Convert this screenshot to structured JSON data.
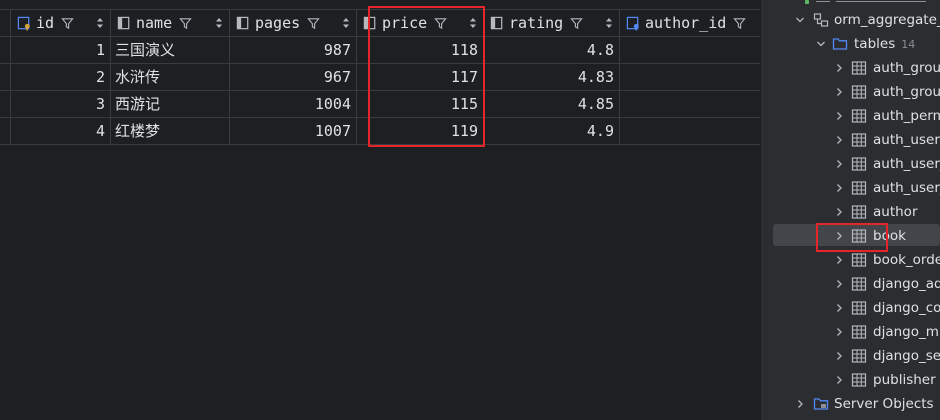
{
  "grid": {
    "columns": [
      {
        "name": "id",
        "icon": "key-column-icon"
      },
      {
        "name": "name",
        "icon": "column-icon"
      },
      {
        "name": "pages",
        "icon": "column-icon"
      },
      {
        "name": "price",
        "icon": "column-icon"
      },
      {
        "name": "rating",
        "icon": "column-icon"
      },
      {
        "name": "author_id",
        "icon": "foreign-key-column-icon"
      }
    ],
    "rows": [
      {
        "id": "1",
        "name": "三国演义",
        "pages": "987",
        "price": "118",
        "rating": "4.8"
      },
      {
        "id": "2",
        "name": "水浒传",
        "pages": "967",
        "price": "117",
        "rating": "4.83"
      },
      {
        "id": "3",
        "name": "西游记",
        "pages": "1004",
        "price": "115",
        "rating": "4.85"
      },
      {
        "id": "4",
        "name": "红楼梦",
        "pages": "1007",
        "price": "119",
        "rating": "4.9"
      }
    ]
  },
  "sidebar": {
    "schema": {
      "label": "orm_aggregate_d"
    },
    "tables_folder": {
      "label": "tables",
      "count": "14"
    },
    "tables": [
      "auth_group",
      "auth_group_",
      "auth_perm",
      "auth_user",
      "auth_user_",
      "auth_user_",
      "author",
      "book",
      "book_order",
      "django_adm",
      "django_con",
      "django_migr",
      "django_ses",
      "publisher"
    ],
    "server_objects": {
      "label": "Server Objects"
    }
  },
  "colors": {
    "background": "#1e1f22",
    "sidebar_bg": "#2b2d30",
    "highlight_red": "#e5252a",
    "selection": "#43454a",
    "text": "#dfe1e5"
  }
}
